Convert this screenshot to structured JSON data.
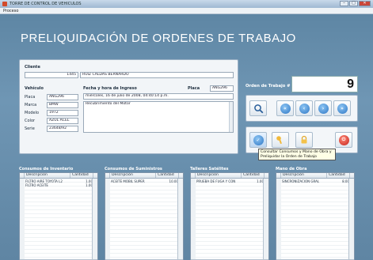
{
  "window": {
    "title": "TORRE DE CONTROL DE VEHICULOS",
    "controls": {
      "minimize": "–",
      "maximize": "□",
      "close": "✕"
    }
  },
  "menu": {
    "items": [
      "Proceso"
    ]
  },
  "page": {
    "title": "PRELIQUIDACIÓN DE ORDENES DE TRABAJO"
  },
  "cliente": {
    "label": "Cliente",
    "id": "1445",
    "nombre": "RUIZ CALDAS BERNARDO"
  },
  "vehiculo": {
    "label": "Vehículo",
    "fields": [
      {
        "label": "Placa",
        "value": "ANG296"
      },
      {
        "label": "Marca",
        "value": "BMW"
      },
      {
        "label": "Modelo",
        "value": "1972"
      },
      {
        "label": "Color",
        "value": "AZUL ACEL"
      },
      {
        "label": "Serie",
        "value": "23648/92"
      }
    ]
  },
  "ingreso": {
    "label": "Fecha y hora de Ingreso",
    "fecha": "miércoles, 16 de julio de 2008, 04:40:14 p.m.",
    "placa_label": "Placa",
    "placa": "ANG296",
    "descripcion": "Recubrimiento del Motor"
  },
  "orden": {
    "label": "Orden de Trabajo #",
    "numero": "9"
  },
  "tooltip": {
    "text": "Consultar Consumos y Mano de Obra y Preliquidar la Orden de Trabajo"
  },
  "grids": [
    {
      "title": "Consumos de Inventario",
      "col_desc": "Descripción",
      "col_qty": "Cantidad",
      "rows": [
        {
          "desc": "FILTRO AIRE TOYOTA L2",
          "qty": "1.00"
        },
        {
          "desc": "FILTRO ACEITE",
          "qty": "1.00"
        }
      ]
    },
    {
      "title": "Consumos de Suministros",
      "col_desc": "Descripción",
      "col_qty": "Cantidad",
      "rows": [
        {
          "desc": "ACEITE MOBIL SUPER",
          "qty": "10.00"
        }
      ]
    },
    {
      "title": "Talleres Satélites",
      "col_desc": "Descripción",
      "col_qty": "Cantidad",
      "rows": [
        {
          "desc": "PRUEBA DE FUGA Y CON",
          "qty": "1.00"
        }
      ]
    },
    {
      "title": "Mano de Obra",
      "col_desc": "Descripción",
      "col_qty": "Cantidad",
      "rows": [
        {
          "desc": "SINCRONIZACION GRAL",
          "qty": "8.00"
        }
      ]
    }
  ],
  "colors": {
    "background": "#6b8fa8",
    "panel": "#f2f5f8",
    "accent_blue": "#2d76c4",
    "accent_red": "#c4221a"
  },
  "icons": [
    "search-icon",
    "first-icon",
    "prev-icon",
    "next-icon",
    "last-icon",
    "confirm-icon",
    "key-icon",
    "lock-icon",
    "power-icon"
  ]
}
